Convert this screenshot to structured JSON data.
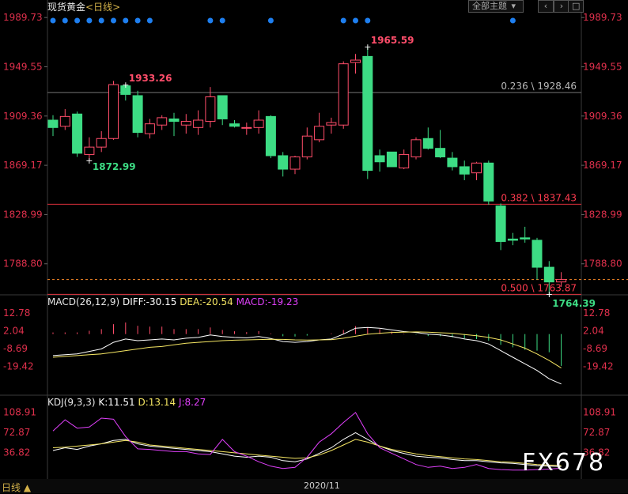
{
  "header": {
    "title": "现货黄金",
    "period_bracket_open": "<",
    "period": "日线",
    "period_bracket_close": ">",
    "theme_button": "全部主题"
  },
  "price_axis": {
    "left_ticks": [
      "1989.73",
      "1949.55",
      "1909.36",
      "1869.17",
      "1828.99",
      "1788.80"
    ],
    "right_ticks": [
      "1989.73",
      "1949.55",
      "1909.36",
      "1869.17",
      "1828.99",
      "1788.80"
    ]
  },
  "annotations": {
    "high_label": "1965.59",
    "local_high": "1933.26",
    "local_low": "1872.99",
    "last_low": "1764.39",
    "fib": [
      "0.236 \\ 1928.46",
      "0.382 \\ 1837.43",
      "0.500 \\ 1763.87"
    ]
  },
  "macd_panel": {
    "title": "MACD(26,12,9)",
    "diff": "DIFF:-30.15",
    "dea": "DEA:-20.54",
    "macd": "MACD:-19.23",
    "ticks": [
      "12.78",
      "2.04",
      "-8.69",
      "-19.42"
    ]
  },
  "kdj_panel": {
    "title": "KDJ(9,3,3)",
    "k": "K:11.51",
    "d": "D:13.14",
    "j": "J:8.27",
    "ticks": [
      "108.91",
      "72.87",
      "36.82"
    ]
  },
  "footer": {
    "period_label": "日线",
    "date_label": "2020/11"
  },
  "watermark": "FX678",
  "colors": {
    "up": "#ff4d6a",
    "down": "#3ddc84",
    "diff": "#ffffff",
    "dea": "#f5e663",
    "j": "#e040fb",
    "fib_red": "#e0303c",
    "fib_gray": "#777777",
    "dot": "#1e7ff0"
  },
  "chart_data": {
    "type": "candlestick",
    "series": [
      {
        "ohlc": [
          [
            1906,
            1910,
            1893,
            1900
          ],
          [
            1901,
            1915,
            1898,
            1909
          ],
          [
            1911,
            1913,
            1876,
            1879
          ],
          [
            1878,
            1892,
            1873,
            1884
          ],
          [
            1884,
            1897,
            1880,
            1891
          ],
          [
            1891,
            1938,
            1890,
            1935
          ],
          [
            1934,
            1935,
            1922,
            1927
          ],
          [
            1926,
            1930,
            1892,
            1896
          ],
          [
            1895,
            1907,
            1891,
            1903
          ],
          [
            1902,
            1910,
            1898,
            1908
          ],
          [
            1907,
            1912,
            1893,
            1905
          ],
          [
            1902,
            1911,
            1895,
            1905
          ],
          [
            1900,
            1914,
            1894,
            1906
          ],
          [
            1905,
            1933,
            1900,
            1925
          ],
          [
            1926,
            1926,
            1902,
            1907
          ],
          [
            1903,
            1906,
            1900,
            1901
          ],
          [
            1900,
            1904,
            1894,
            1900
          ],
          [
            1900,
            1914,
            1895,
            1906
          ],
          [
            1909,
            1910,
            1875,
            1877
          ],
          [
            1877,
            1880,
            1860,
            1866
          ],
          [
            1866,
            1877,
            1862,
            1876
          ],
          [
            1876,
            1900,
            1874,
            1893
          ],
          [
            1890,
            1912,
            1888,
            1901
          ],
          [
            1902,
            1908,
            1895,
            1904
          ],
          [
            1902,
            1954,
            1899,
            1952
          ],
          [
            1953,
            1960,
            1944,
            1955
          ],
          [
            1958,
            1966,
            1858,
            1865
          ],
          [
            1877,
            1882,
            1864,
            1872
          ],
          [
            1880,
            1880,
            1868,
            1868
          ],
          [
            1867,
            1882,
            1866,
            1878
          ],
          [
            1876,
            1892,
            1874,
            1890
          ],
          [
            1891,
            1900,
            1882,
            1883
          ],
          [
            1883,
            1898,
            1875,
            1876
          ],
          [
            1875,
            1880,
            1865,
            1868
          ],
          [
            1868,
            1873,
            1857,
            1862
          ],
          [
            1863,
            1872,
            1857,
            1871
          ],
          [
            1871,
            1873,
            1837,
            1840
          ],
          [
            1836,
            1838,
            1800,
            1807
          ],
          [
            1809,
            1814,
            1804,
            1808
          ],
          [
            1810,
            1819,
            1806,
            1809
          ],
          [
            1808,
            1810,
            1776,
            1786
          ],
          [
            1786,
            1791,
            1764,
            1774
          ],
          [
            1774,
            1782,
            1770,
            1776
          ]
        ],
        "diff": [
          -13,
          -12.5,
          -12,
          -10.5,
          -9,
          -5,
          -3,
          -4,
          -3.5,
          -3,
          -3.5,
          -2.5,
          -2,
          -0.5,
          -1.5,
          -2,
          -2.3,
          -1.5,
          -2.7,
          -4.5,
          -5,
          -4.5,
          -3.5,
          -3,
          0,
          3.5,
          4,
          3.5,
          2.5,
          1.5,
          1,
          0,
          -0.5,
          -1.5,
          -3,
          -4,
          -6,
          -10,
          -14,
          -18,
          -22,
          -27,
          -30.15
        ],
        "dea": [
          -14,
          -13.5,
          -13,
          -12.5,
          -12,
          -11,
          -10,
          -9,
          -8,
          -7.5,
          -6.5,
          -5.5,
          -5,
          -4.5,
          -4,
          -3.7,
          -3.5,
          -3.3,
          -3.1,
          -3.2,
          -3.5,
          -3.6,
          -3.5,
          -3.4,
          -2.5,
          -1.3,
          -0.1,
          0.5,
          1,
          1.2,
          1.3,
          1.2,
          0.8,
          0.5,
          -0.3,
          -1,
          -2,
          -3.5,
          -6,
          -8.5,
          -12,
          -16,
          -20.54
        ],
        "macd": [
          1,
          1,
          1,
          2,
          3,
          6,
          7,
          5,
          4.5,
          4.5,
          3,
          3,
          3,
          4,
          2.5,
          1.7,
          1.2,
          1.8,
          0.4,
          -1.3,
          -1.5,
          -0.9,
          0,
          0.4,
          2.5,
          4.8,
          4.1,
          3,
          1.5,
          0.3,
          -0.3,
          -1.2,
          -1.3,
          -2,
          -2.7,
          -3,
          -4,
          -6.5,
          -8,
          -9.5,
          -10,
          -11,
          -19.23
        ],
        "k": [
          40,
          45,
          42,
          48,
          52,
          58,
          60,
          52,
          48,
          46,
          44,
          42,
          40,
          38,
          34,
          30,
          28,
          30,
          28,
          22,
          20,
          25,
          35,
          45,
          60,
          72,
          60,
          48,
          40,
          35,
          30,
          28,
          27,
          24,
          22,
          22,
          20,
          18,
          17,
          15,
          13,
          12,
          11.51
        ],
        "d": [
          45,
          46,
          48,
          50,
          52,
          55,
          58,
          55,
          50,
          48,
          46,
          44,
          42,
          40,
          38,
          36,
          34,
          32,
          30,
          28,
          26,
          27,
          32,
          40,
          50,
          60,
          55,
          48,
          42,
          38,
          34,
          31,
          29,
          27,
          25,
          24,
          22,
          20,
          19,
          17,
          15,
          14,
          13.14
        ],
        "j": [
          75,
          95,
          80,
          82,
          98,
          96,
          65,
          43,
          42,
          40,
          38,
          38,
          34,
          33,
          60,
          38,
          30,
          20,
          12,
          8,
          10,
          28,
          55,
          70,
          90,
          108,
          70,
          45,
          35,
          25,
          15,
          10,
          12,
          8,
          10,
          15,
          8,
          6,
          5,
          5,
          6,
          7,
          8.27
        ]
      }
    ],
    "signal_dots": [
      0,
      1,
      2,
      3,
      4,
      5,
      6,
      7,
      8,
      13,
      14,
      18,
      24,
      25,
      26,
      38
    ],
    "fib_levels": [
      {
        "label": "0.236",
        "value": 1928.46
      },
      {
        "label": "0.382",
        "value": 1837.43
      },
      {
        "label": "0.500",
        "value": 1763.87
      }
    ],
    "xlabel": "2020/11",
    "ylim": [
      1768,
      1995
    ],
    "macd_ylim": [
      -36,
      18
    ],
    "kdj_ylim": [
      -8,
      122
    ],
    "legend": "top-left"
  }
}
